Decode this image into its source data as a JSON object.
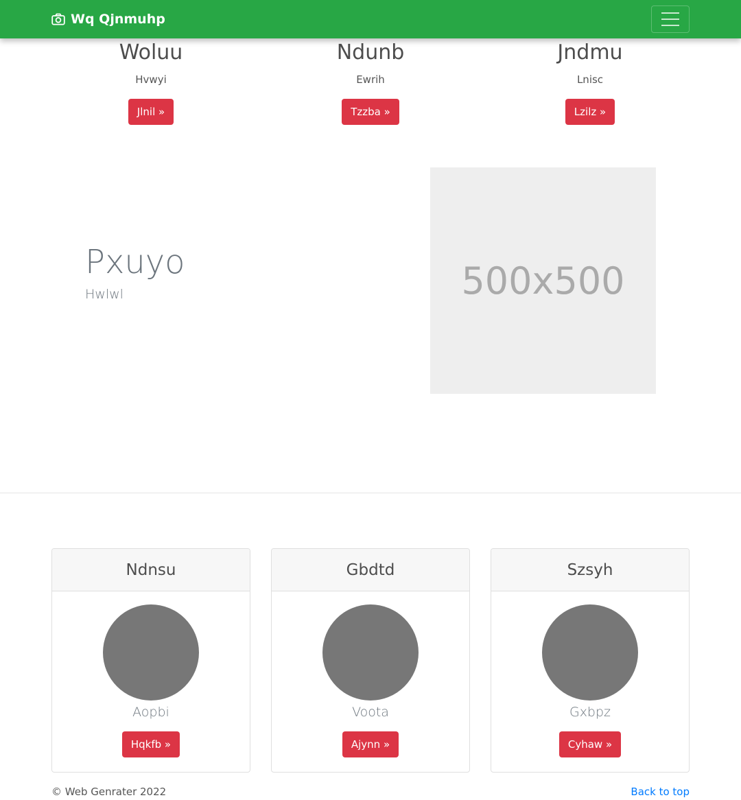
{
  "navbar": {
    "brand": "Wq Qjnmuhp",
    "brand_icon": "camera-icon",
    "toggler_icon": "hamburger-menu-icon",
    "color": "#28a745"
  },
  "features": [
    {
      "title": "Woluu",
      "text": "Hvwyi",
      "button": "Jlnil »"
    },
    {
      "title": "Ndunb",
      "text": "Ewrih",
      "button": "Tzzba »"
    },
    {
      "title": "Jndmu",
      "text": "Lnisc",
      "button": "Lzilz »"
    }
  ],
  "hero": {
    "title": "Pxuyo",
    "subtitle": "Hwlwl",
    "image_placeholder": "500x500"
  },
  "cards": [
    {
      "header": "Ndnsu",
      "name": "Aopbi",
      "button": "Hqkfb »"
    },
    {
      "header": "Gbdtd",
      "name": "Voota",
      "button": "Ajynn »"
    },
    {
      "header": "Szsyh",
      "name": "Gxbpz",
      "button": "Cyhaw »"
    }
  ],
  "footer": {
    "copyright": "© Web Genrater 2022",
    "back_to_top": "Back to top"
  },
  "colors": {
    "accent_button": "#dc3545",
    "link": "#007bff"
  }
}
